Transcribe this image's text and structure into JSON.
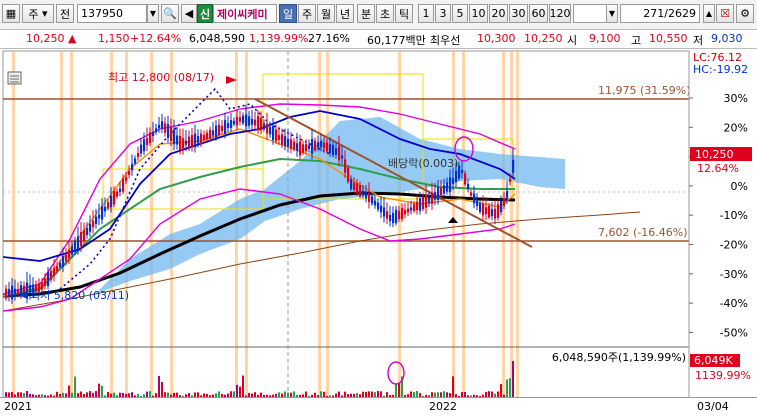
{
  "toolbar": {
    "menu_label": "주",
    "prev_label": "전",
    "stock_code": "137950",
    "credit_badge": "신",
    "stock_name": "제이씨케미",
    "periods": [
      "일",
      "주",
      "월",
      "년",
      "분",
      "초",
      "틱"
    ],
    "intervals": [
      "1",
      "3",
      "5",
      "10",
      "20",
      "30",
      "60",
      "120"
    ],
    "record_position": "271",
    "record_total": "/2629"
  },
  "quote": {
    "price": "10,250",
    "change": "1,150",
    "change_pct": "+12.64%",
    "volume": "6,048,590",
    "volume_ratio": "1,139.99%",
    "turnover_rate": "27.16%",
    "trade_amount": "60,177백만",
    "best_bid_label": "최우선",
    "best_ask": "10,300",
    "best_bid": "10,250",
    "open_label": "시",
    "open": "9,100",
    "high_label": "고",
    "high": "10,550",
    "low_label": "저",
    "low": "9,030"
  },
  "chart_data": {
    "type": "candlestick",
    "x_labels": [
      "2021",
      "2022",
      "03/04"
    ],
    "y_axis_ticks": [
      "30%",
      "20%",
      "10%",
      "0%",
      "-10%",
      "-20%",
      "-30%",
      "-40%",
      "-50%"
    ],
    "annotations": {
      "high": "최고 12,800 (08/17)",
      "low": "최저 5,820 (03/11)",
      "dividend": "배당락(0.003)",
      "resistance": "11,975 (31.59%)",
      "support": "7,602 (-16.46%)",
      "lc": "LC:76.12",
      "hc": "HC:-19.92",
      "current_price": "10,250",
      "current_pct": "12.64%",
      "volume_total": "6,048,590주(1,139.99%)",
      "volume_value": "6,049K",
      "volume_pct": "1139.99%"
    },
    "colors": {
      "up": "#e0001b",
      "down": "#0033cc",
      "ma_short": "#ff8a00",
      "ma_mid": "#2e9e4a",
      "ma_long": "#000000",
      "bollinger_upper": "#e000e0",
      "bollinger_lower": "#e000e0",
      "cloud": "#70b8f0",
      "trendline": "#a0522d",
      "level_line": "#a0522d",
      "highlight_box": "#f0e000",
      "vertical_band": "#ffb060"
    },
    "resistance_level_pct": 31.59,
    "support_level_pct": -16.46
  }
}
